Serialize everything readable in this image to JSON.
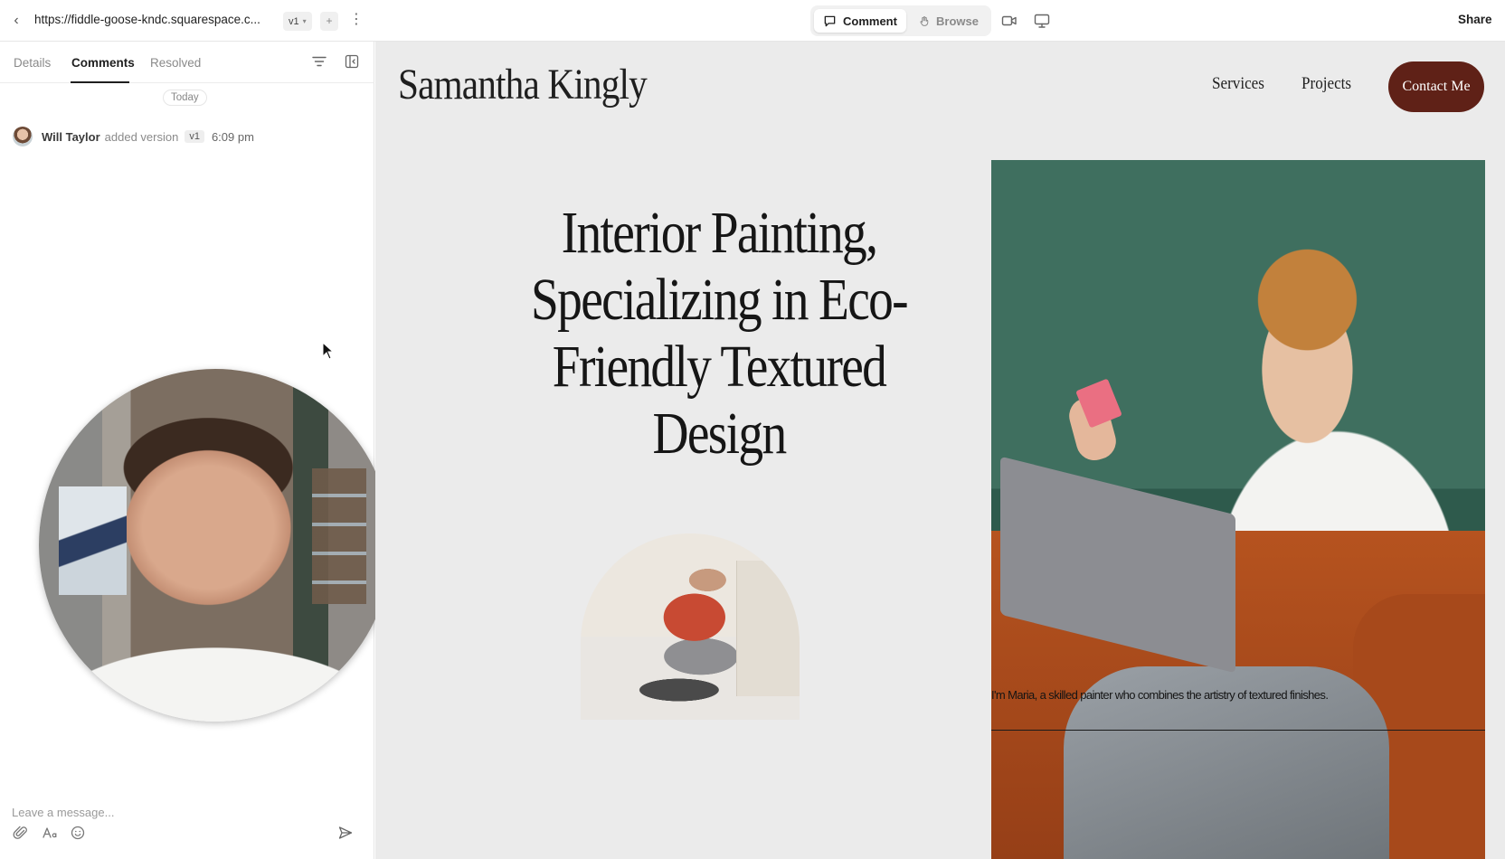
{
  "topbar": {
    "url": "https://fiddle-goose-kndc.squarespace.c...",
    "version": "v1",
    "plus": "+",
    "more": "⋮",
    "back": "‹",
    "modes": {
      "comment": "Comment",
      "browse": "Browse"
    },
    "share": "Share"
  },
  "panel": {
    "tabs": {
      "details": "Details",
      "comments": "Comments",
      "resolved": "Resolved"
    },
    "today": "Today",
    "activity": {
      "name": "Will Taylor",
      "verb": "added version",
      "version": "v1",
      "time": "6:09 pm"
    },
    "message_placeholder": "Leave a message..."
  },
  "site": {
    "title": "Samantha Kingly",
    "nav": {
      "services": "Services",
      "projects": "Projects",
      "contact": "Contact Me"
    },
    "hero": [
      "Interior Painting,",
      "Specializing in Eco-",
      "Friendly Textured",
      "Design"
    ],
    "caption": "I'm Maria, a skilled painter who combines the artistry of textured finishes."
  },
  "colors": {
    "accent": "#5f2117",
    "preview_bg": "#ebebeb"
  }
}
